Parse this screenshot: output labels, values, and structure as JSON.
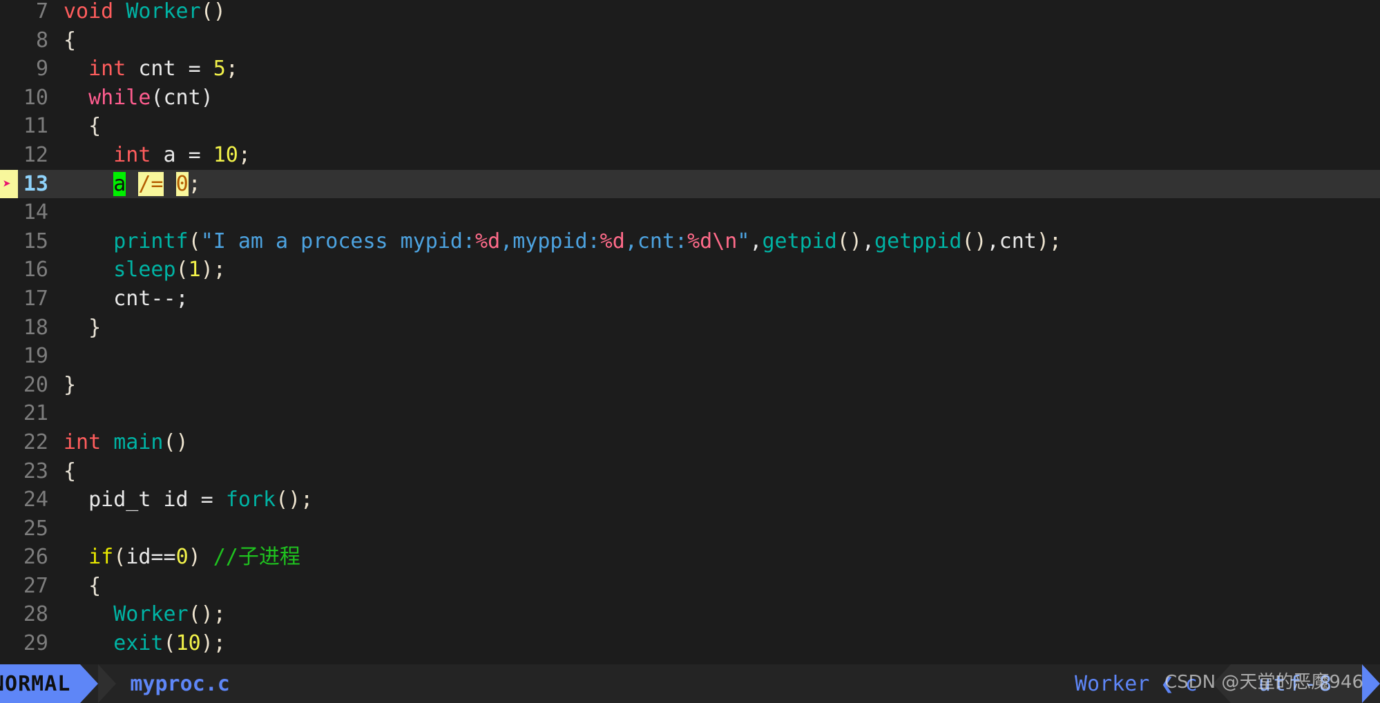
{
  "editor": {
    "app": "vim",
    "colors": {
      "background": "#1c1c1c",
      "cursorline": "#333333",
      "linenr": "#7d7d7d",
      "cursor_linenr": "#8fd3fb",
      "accent_blue": "#5e86f7",
      "sign_bg": "#f8f79c",
      "sign_arrow": "#e8136e",
      "keyword_red": "#ff5d5d",
      "keyword_pink": "#ff5d8f",
      "keyword_yellow": "#e8e800",
      "function_teal": "#00b3a4",
      "number_yellow": "#f2f24a",
      "string_blue": "#4da3e0",
      "escape_pink": "#ff6b8a",
      "comment_green": "#1fc31f",
      "highlight_green": "#00f000",
      "highlight_yellow": "#f8f79c"
    },
    "sign_marker": "➤",
    "lines": [
      {
        "num": "7",
        "cursor": false
      },
      {
        "num": "8",
        "cursor": false
      },
      {
        "num": "9",
        "cursor": false
      },
      {
        "num": "10",
        "cursor": false
      },
      {
        "num": "11",
        "cursor": false
      },
      {
        "num": "12",
        "cursor": false
      },
      {
        "num": "13",
        "cursor": true
      },
      {
        "num": "14",
        "cursor": false
      },
      {
        "num": "15",
        "cursor": false
      },
      {
        "num": "16",
        "cursor": false
      },
      {
        "num": "17",
        "cursor": false
      },
      {
        "num": "18",
        "cursor": false
      },
      {
        "num": "19",
        "cursor": false
      },
      {
        "num": "20",
        "cursor": false
      },
      {
        "num": "21",
        "cursor": false
      },
      {
        "num": "22",
        "cursor": false
      },
      {
        "num": "23",
        "cursor": false
      },
      {
        "num": "24",
        "cursor": false
      },
      {
        "num": "25",
        "cursor": false
      },
      {
        "num": "26",
        "cursor": false
      },
      {
        "num": "27",
        "cursor": false
      },
      {
        "num": "28",
        "cursor": false
      },
      {
        "num": "29",
        "cursor": false
      }
    ],
    "code": {
      "l7_void": "void ",
      "l7_worker": "Worker",
      "l7_paren": "()",
      "l8_brace": "{",
      "l9_indent": "  ",
      "l9_int": "int",
      "l9_cnt": " cnt = ",
      "l9_num": "5",
      "l9_semi": ";",
      "l10_indent": "  ",
      "l10_while": "while",
      "l10_paren": "(cnt)",
      "l11_brace": "  {",
      "l12_indent": "    ",
      "l12_int": "int",
      "l12_a": " a = ",
      "l12_num": "10",
      "l12_semi": ";",
      "l13_indent": "    ",
      "l13_a": "a",
      "l13_gap1": " ",
      "l13_op": "/=",
      "l13_gap2": " ",
      "l13_zero": "0",
      "l13_semi": ";",
      "l14_blank": "",
      "l15_indent": "    ",
      "l15_printf": "printf",
      "l15_lparen": "(",
      "l15_str1": "\"I am a process mypid:",
      "l15_pct1": "%d",
      "l15_str2": ",myppid:",
      "l15_pct2": "%d",
      "l15_str3": ",cnt:",
      "l15_pct3": "%d",
      "l15_esc": "\\n",
      "l15_quote": "\"",
      "l15_comma1": ",",
      "l15_getpid": "getpid",
      "l15_p1": "()",
      "l15_comma2": ",",
      "l15_getppid": "getppid",
      "l15_p2": "()",
      "l15_comma3": ",",
      "l15_cnt": "cnt",
      "l15_end": ");",
      "l16_indent": "    ",
      "l16_sleep": "sleep",
      "l16_lp": "(",
      "l16_num": "1",
      "l16_rp": ");",
      "l17_text": "    cnt--;",
      "l18_brace": "  }",
      "l19_blank": "",
      "l20_brace": "}",
      "l21_blank": "",
      "l22_int": "int ",
      "l22_main": "main",
      "l22_paren": "()",
      "l23_brace": "{",
      "l24_indent": "  ",
      "l24_pid": "pid_t id = ",
      "l24_fork": "fork",
      "l24_paren": "();",
      "l25_blank": "",
      "l26_indent": "  ",
      "l26_if": "if",
      "l26_lp": "(",
      "l26_id": "id==",
      "l26_zero": "0",
      "l26_rp": ")",
      "l26_comment": " //子进程",
      "l27_brace": "  {",
      "l28_indent": "    ",
      "l28_worker": "Worker",
      "l28_paren": "();",
      "l29_indent": "    ",
      "l29_exit": "exit",
      "l29_lp": "(",
      "l29_num": "10",
      "l29_rp": ");"
    }
  },
  "statusline": {
    "mode": "NORMAL",
    "filename": "myproc.c",
    "function_context": "Worker",
    "separator_glyph": "❮",
    "filetype": "c",
    "encoding": "utf-8"
  },
  "watermark": {
    "text": "CSDN @天堂的恶魔946"
  }
}
